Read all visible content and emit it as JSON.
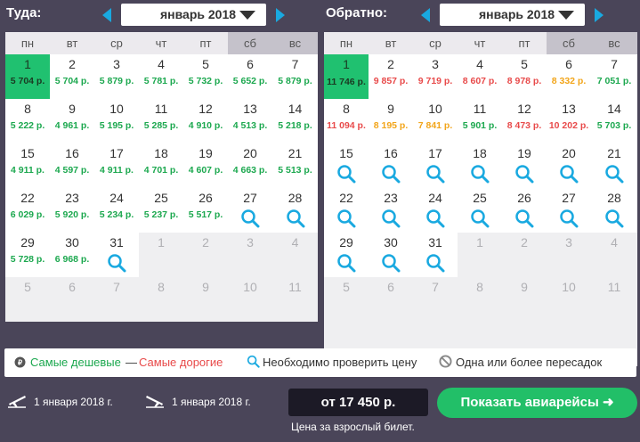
{
  "colors": {
    "accent": "#19a9e0",
    "cheap": "#1ca84f",
    "expensive": "#e84a4a",
    "mid": "#f2a51a",
    "selected": "#20c170",
    "cta": "#22bf68",
    "bg": "#4a4559"
  },
  "weekdays": [
    "пн",
    "вт",
    "ср",
    "чт",
    "пт",
    "сб",
    "вс"
  ],
  "outbound": {
    "label": "Туда:",
    "month": "январь 2018",
    "days": [
      {
        "d": "1",
        "price": "5 704 р.",
        "tone": "green",
        "state": "selected"
      },
      {
        "d": "2",
        "price": "5 704 р.",
        "tone": "green"
      },
      {
        "d": "3",
        "price": "5 879 р.",
        "tone": "green"
      },
      {
        "d": "4",
        "price": "5 781 р.",
        "tone": "green"
      },
      {
        "d": "5",
        "price": "5 732 р.",
        "tone": "green"
      },
      {
        "d": "6",
        "price": "5 652 р.",
        "tone": "green"
      },
      {
        "d": "7",
        "price": "5 879 р.",
        "tone": "green"
      },
      {
        "d": "8",
        "price": "5 222 р.",
        "tone": "green"
      },
      {
        "d": "9",
        "price": "4 961 р.",
        "tone": "green"
      },
      {
        "d": "10",
        "price": "5 195 р.",
        "tone": "green"
      },
      {
        "d": "11",
        "price": "5 285 р.",
        "tone": "green"
      },
      {
        "d": "12",
        "price": "4 910 р.",
        "tone": "green"
      },
      {
        "d": "13",
        "price": "4 513 р.",
        "tone": "green"
      },
      {
        "d": "14",
        "price": "5 218 р.",
        "tone": "green"
      },
      {
        "d": "15",
        "price": "4 911 р.",
        "tone": "green"
      },
      {
        "d": "16",
        "price": "4 597 р.",
        "tone": "green"
      },
      {
        "d": "17",
        "price": "4 911 р.",
        "tone": "green"
      },
      {
        "d": "18",
        "price": "4 701 р.",
        "tone": "green"
      },
      {
        "d": "19",
        "price": "4 607 р.",
        "tone": "green"
      },
      {
        "d": "20",
        "price": "4 663 р.",
        "tone": "green"
      },
      {
        "d": "21",
        "price": "5 513 р.",
        "tone": "green"
      },
      {
        "d": "22",
        "price": "6 029 р.",
        "tone": "green"
      },
      {
        "d": "23",
        "price": "5 920 р.",
        "tone": "green"
      },
      {
        "d": "24",
        "price": "5 234 р.",
        "tone": "green"
      },
      {
        "d": "25",
        "price": "5 237 р.",
        "tone": "green"
      },
      {
        "d": "26",
        "price": "5 517 р.",
        "tone": "green"
      },
      {
        "d": "27",
        "check": true
      },
      {
        "d": "28",
        "check": true
      },
      {
        "d": "29",
        "price": "5 728 р.",
        "tone": "green"
      },
      {
        "d": "30",
        "price": "6 968 р.",
        "tone": "green"
      },
      {
        "d": "31",
        "check": true
      },
      {
        "d": "1",
        "state": "out"
      },
      {
        "d": "2",
        "state": "out"
      },
      {
        "d": "3",
        "state": "out"
      },
      {
        "d": "4",
        "state": "out"
      },
      {
        "d": "5",
        "state": "out"
      },
      {
        "d": "6",
        "state": "out"
      },
      {
        "d": "7",
        "state": "out"
      },
      {
        "d": "8",
        "state": "out"
      },
      {
        "d": "9",
        "state": "out"
      },
      {
        "d": "10",
        "state": "out"
      },
      {
        "d": "11",
        "state": "out"
      }
    ]
  },
  "inbound": {
    "label": "Обратно:",
    "month": "январь 2018",
    "days": [
      {
        "d": "1",
        "price": "11 746 р.",
        "tone": "green",
        "state": "selected2"
      },
      {
        "d": "2",
        "price": "9 857 р.",
        "tone": "red"
      },
      {
        "d": "3",
        "price": "9 719 р.",
        "tone": "red"
      },
      {
        "d": "4",
        "price": "8 607 р.",
        "tone": "red"
      },
      {
        "d": "5",
        "price": "8 978 р.",
        "tone": "red"
      },
      {
        "d": "6",
        "price": "8 332 р.",
        "tone": "orange"
      },
      {
        "d": "7",
        "price": "7 051 р.",
        "tone": "green"
      },
      {
        "d": "8",
        "price": "11 094 р.",
        "tone": "red"
      },
      {
        "d": "9",
        "price": "8 195 р.",
        "tone": "orange"
      },
      {
        "d": "10",
        "price": "7 841 р.",
        "tone": "orange"
      },
      {
        "d": "11",
        "price": "5 901 р.",
        "tone": "green"
      },
      {
        "d": "12",
        "price": "8 473 р.",
        "tone": "red"
      },
      {
        "d": "13",
        "price": "10 202 р.",
        "tone": "red"
      },
      {
        "d": "14",
        "price": "5 703 р.",
        "tone": "green"
      },
      {
        "d": "15",
        "check": true
      },
      {
        "d": "16",
        "check": true
      },
      {
        "d": "17",
        "check": true
      },
      {
        "d": "18",
        "check": true
      },
      {
        "d": "19",
        "check": true
      },
      {
        "d": "20",
        "check": true
      },
      {
        "d": "21",
        "check": true
      },
      {
        "d": "22",
        "check": true
      },
      {
        "d": "23",
        "check": true
      },
      {
        "d": "24",
        "check": true
      },
      {
        "d": "25",
        "check": true
      },
      {
        "d": "26",
        "check": true
      },
      {
        "d": "27",
        "check": true
      },
      {
        "d": "28",
        "check": true
      },
      {
        "d": "29",
        "check": true
      },
      {
        "d": "30",
        "check": true
      },
      {
        "d": "31",
        "check": true
      },
      {
        "d": "1",
        "state": "out"
      },
      {
        "d": "2",
        "state": "out"
      },
      {
        "d": "3",
        "state": "out"
      },
      {
        "d": "4",
        "state": "out"
      },
      {
        "d": "5",
        "state": "out"
      },
      {
        "d": "6",
        "state": "out"
      },
      {
        "d": "7",
        "state": "out"
      },
      {
        "d": "8",
        "state": "out"
      },
      {
        "d": "9",
        "state": "out"
      },
      {
        "d": "10",
        "state": "out"
      },
      {
        "d": "11",
        "state": "out"
      }
    ]
  },
  "legend": {
    "cheapest": "Самые дешевые",
    "dash": " — ",
    "expensive": "Самые дорогие",
    "check_price": "Необходимо проверить цену",
    "transfers": "Одна или более пересадок"
  },
  "summary": {
    "depart_date": "1 января 2018 г.",
    "return_date": "1 января 2018 г.",
    "price": "от 17 450 р.",
    "price_note": "Цена за взрослый билет.",
    "show_button": "Показать авиарейсы ➜"
  }
}
